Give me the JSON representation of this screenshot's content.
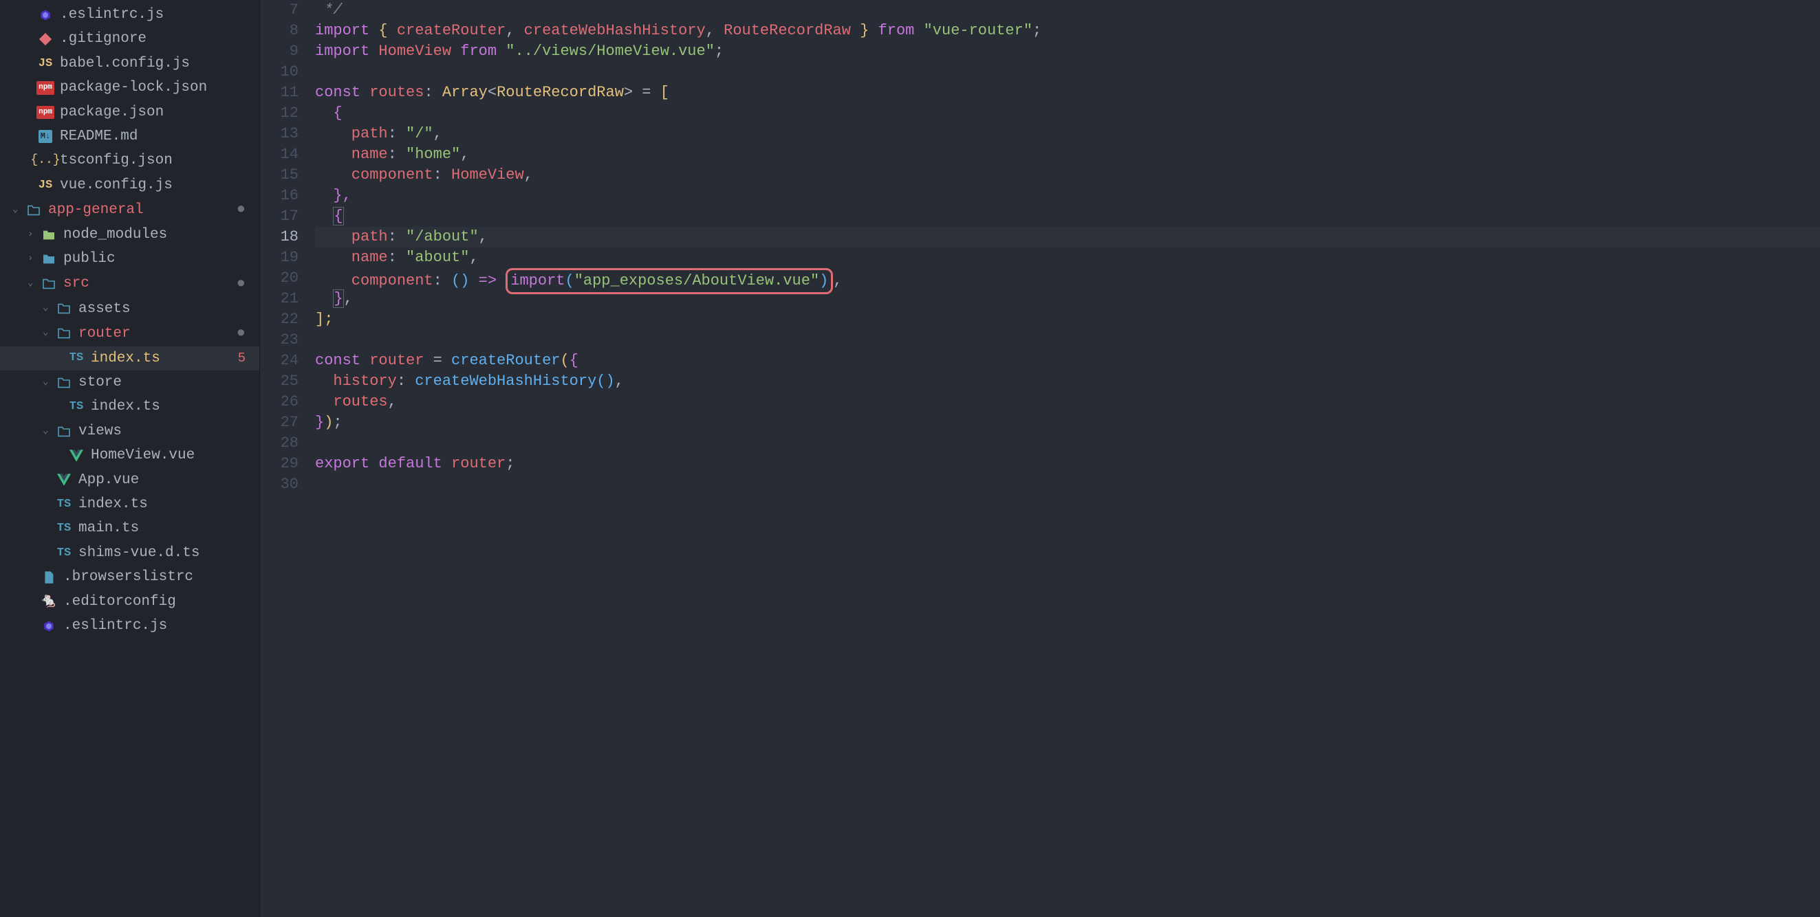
{
  "sidebar": {
    "items": [
      {
        "name": ".eslintrc.js",
        "icon": "eslint",
        "indent": 0,
        "chevron": ""
      },
      {
        "name": ".gitignore",
        "icon": "git",
        "indent": 0,
        "chevron": ""
      },
      {
        "name": "babel.config.js",
        "icon": "js",
        "indent": 0,
        "chevron": ""
      },
      {
        "name": "package-lock.json",
        "icon": "npm",
        "indent": 0,
        "chevron": ""
      },
      {
        "name": "package.json",
        "icon": "npm",
        "indent": 0,
        "chevron": ""
      },
      {
        "name": "README.md",
        "icon": "md",
        "indent": 0,
        "chevron": ""
      },
      {
        "name": "tsconfig.json",
        "icon": "json",
        "indent": 0,
        "chevron": ""
      },
      {
        "name": "vue.config.js",
        "icon": "js",
        "indent": 0,
        "chevron": ""
      },
      {
        "name": "app-general",
        "icon": "folder-open",
        "indent": 1,
        "chevron": "⌄",
        "modified_folder": true,
        "dot": true
      },
      {
        "name": "node_modules",
        "icon": "folder-green",
        "indent": 2,
        "chevron": "›"
      },
      {
        "name": "public",
        "icon": "folder",
        "indent": 2,
        "chevron": "›"
      },
      {
        "name": "src",
        "icon": "folder-open",
        "indent": 2,
        "chevron": "⌄",
        "modified_folder": true,
        "dot": true
      },
      {
        "name": "assets",
        "icon": "folder-open",
        "indent": 3,
        "chevron": "⌄"
      },
      {
        "name": "router",
        "icon": "folder-open",
        "indent": 3,
        "chevron": "⌄",
        "modified_folder": true,
        "dot": true
      },
      {
        "name": "index.ts",
        "icon": "ts",
        "indent": 4,
        "chevron": "",
        "selected": true,
        "modified": true,
        "error_count": "5"
      },
      {
        "name": "store",
        "icon": "folder-open",
        "indent": 3,
        "chevron": "⌄"
      },
      {
        "name": "index.ts",
        "icon": "ts",
        "indent": 4,
        "chevron": ""
      },
      {
        "name": "views",
        "icon": "folder-open",
        "indent": 3,
        "chevron": "⌄"
      },
      {
        "name": "HomeView.vue",
        "icon": "vue",
        "indent": 4,
        "chevron": ""
      },
      {
        "name": "App.vue",
        "icon": "vue",
        "indent": 3,
        "chevron": ""
      },
      {
        "name": "index.ts",
        "icon": "ts",
        "indent": 3,
        "chevron": ""
      },
      {
        "name": "main.ts",
        "icon": "ts",
        "indent": 3,
        "chevron": ""
      },
      {
        "name": "shims-vue.d.ts",
        "icon": "ts",
        "indent": 3,
        "chevron": ""
      },
      {
        "name": ".browserslistrc",
        "icon": "file",
        "indent": 2,
        "chevron": ""
      },
      {
        "name": ".editorconfig",
        "icon": "editorconfig",
        "indent": 2,
        "chevron": ""
      },
      {
        "name": ".eslintrc.js",
        "icon": "eslint",
        "indent": 2,
        "chevron": ""
      }
    ]
  },
  "editor": {
    "line_numbers": [
      "7",
      "8",
      "9",
      "10",
      "11",
      "12",
      "13",
      "14",
      "15",
      "16",
      "17",
      "18",
      "19",
      "20",
      "21",
      "22",
      "23",
      "24",
      "25",
      "26",
      "27",
      "28",
      "29",
      "30"
    ],
    "current_line_index": 11,
    "code": {
      "l7": " */",
      "l8_import": "import",
      "l8_brace1": " { ",
      "l8_fn1": "createRouter",
      "l8_c1": ", ",
      "l8_fn2": "createWebHashHistory",
      "l8_c2": ", ",
      "l8_type1": "RouteRecordRaw",
      "l8_brace2": " } ",
      "l8_from": "from ",
      "l8_str": "\"vue-router\"",
      "l8_sc": ";",
      "l9_import": "import",
      "l9_var": " HomeView ",
      "l9_from": "from ",
      "l9_str": "\"../views/HomeView.vue\"",
      "l9_sc": ";",
      "l11_const": "const",
      "l11_var": " routes",
      "l11_colon": ": ",
      "l11_type1": "Array",
      "l11_lt": "<",
      "l11_type2": "RouteRecordRaw",
      "l11_gt": ">",
      "l11_eq": " = ",
      "l11_br": "[",
      "l12_br": "  {",
      "l13_prop": "    path",
      "l13_c": ": ",
      "l13_str": "\"/\"",
      "l13_cm": ",",
      "l14_prop": "    name",
      "l14_c": ": ",
      "l14_str": "\"home\"",
      "l14_cm": ",",
      "l15_prop": "    component",
      "l15_c": ": ",
      "l15_var": "HomeView",
      "l15_cm": ",",
      "l16_br": "  },",
      "l17_br": "  {",
      "l18_prop": "    path",
      "l18_c": ": ",
      "l18_str": "\"/about\"",
      "l18_cm": ",",
      "l19_prop": "    name",
      "l19_c": ": ",
      "l19_str": "\"about\"",
      "l19_cm": ",",
      "l20_prop": "    component",
      "l20_c": ": ",
      "l20_paren": "()",
      "l20_arrow": " => ",
      "l20_import": "import",
      "l20_p1": "(",
      "l20_str": "\"app_exposes/AboutView.vue\"",
      "l20_p2": ")",
      "l20_cm": ",",
      "l21_br": "  }",
      "l21_cm": ",",
      "l22_br": "];",
      "l24_const": "const",
      "l24_var": " router ",
      "l24_eq": "= ",
      "l24_fn": "createRouter",
      "l24_p1": "(",
      "l24_br": "{",
      "l25_prop": "  history",
      "l25_c": ": ",
      "l25_fn": "createWebHashHistory",
      "l25_paren": "()",
      "l25_cm": ",",
      "l26_var": "  routes",
      "l26_cm": ",",
      "l27_br": "}",
      "l27_p": ")",
      "l27_sc": ";",
      "l29_export": "export",
      "l29_default": " default",
      "l29_var": " router",
      "l29_sc": ";"
    }
  }
}
